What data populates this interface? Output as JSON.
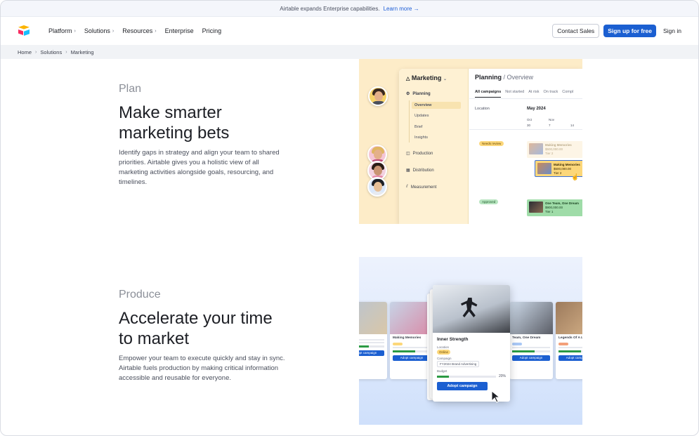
{
  "banner": {
    "text": "Airtable expands Enterprise capabilities.",
    "link": "Learn more →"
  },
  "nav": {
    "items": [
      {
        "label": "Platform",
        "has_chevron": true
      },
      {
        "label": "Solutions",
        "has_chevron": true
      },
      {
        "label": "Resources",
        "has_chevron": true
      },
      {
        "label": "Enterprise",
        "has_chevron": false
      },
      {
        "label": "Pricing",
        "has_chevron": false
      }
    ],
    "chevron": "›",
    "contact_sales": "Contact Sales",
    "sign_up": "Sign up for free",
    "sign_in": "Sign in"
  },
  "breadcrumb": {
    "items": [
      "Home",
      "Solutions",
      "Marketing"
    ],
    "separator": "›"
  },
  "plan": {
    "eyebrow": "Plan",
    "title_line1": "Make smarter",
    "title_line2": "marketing bets",
    "body_line1": "Identify gaps in strategy and align your team to shared",
    "body_line2": "priorities. Airtable gives you a holistic view of all",
    "body_line3": "marketing activities alongside goals, resourcing, and",
    "body_line4": "timelines.",
    "app": {
      "workspace": "Marketing",
      "workspace_chevron": "⌄",
      "sidebar": {
        "planning": "Planning",
        "overview": "Overview",
        "updates": "Updates",
        "brief": "Brief",
        "insights": "Insights",
        "production": "Production",
        "distribution": "Distribution",
        "measurement": "Measurement"
      },
      "crumb_bold": "Planning",
      "crumb_light": "/ Overview",
      "tabs": [
        "All campaigns",
        "Not started",
        "At risk",
        "On track",
        "Compl"
      ],
      "location_label": "Location",
      "month": "May 2024",
      "ticks": [
        "Oct",
        "Nov"
      ],
      "tick_numbers": [
        "30",
        "7",
        "14"
      ],
      "status_needs_review": "Needs review",
      "status_approved": "Approved",
      "cards": [
        {
          "title": "Making Memories",
          "amount": "$500,000.00",
          "tier": "Tier 2"
        },
        {
          "title": "Making Memories",
          "amount": "$500,000.00",
          "tier": "Tier 2"
        },
        {
          "title": "One Team, One Dream",
          "amount": "$900,000.00",
          "tier": "Tier 1"
        }
      ]
    }
  },
  "produce": {
    "eyebrow": "Produce",
    "title_line1": "Accelerate your time",
    "title_line2": "to market",
    "body_line1": "Empower your team to execute quickly and stay in sync.",
    "body_line2": "Airtable fuels production by making critical information",
    "body_line3": "accessible and reusable for everyone.",
    "app": {
      "side_cards": [
        {
          "title": "Making Memories",
          "button": "Adopt campaign"
        },
        {
          "title": "Team, One Dream",
          "button": "Adopt campaign"
        },
        {
          "title": "Legends Of A Lo",
          "button": "Adopt campaign"
        },
        {
          "title": "",
          "button": "Adopt campaign"
        }
      ],
      "main_card": {
        "title": "Inner Strength",
        "status_label": "Location",
        "status_value": "Online",
        "campaign_label": "Campaign",
        "campaign_value": "FY2024 Brand Advertising",
        "budget_label": "Budget",
        "budget_percent_text": "20%",
        "budget_fraction": 0.2,
        "button": "Adopt campaign"
      },
      "side_percent": "20%"
    }
  },
  "colors": {
    "accent": "#1b5fd1",
    "plan_panel_bg": "#fdecc8",
    "yellow_pill": "#fcd77a",
    "green_pill": "#b7e4bf"
  }
}
